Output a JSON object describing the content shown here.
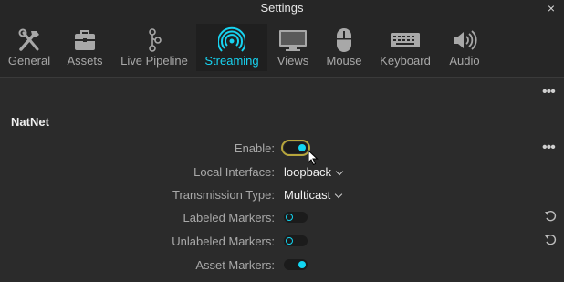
{
  "window": {
    "title": "Settings",
    "close_glyph": "×"
  },
  "tabs": [
    {
      "label": "General",
      "icon": "tools-icon"
    },
    {
      "label": "Assets",
      "icon": "toolbox-icon"
    },
    {
      "label": "Live Pipeline",
      "icon": "pipeline-icon"
    },
    {
      "label": "Streaming",
      "icon": "streaming-icon",
      "active": true
    },
    {
      "label": "Views",
      "icon": "monitor-icon"
    },
    {
      "label": "Mouse",
      "icon": "mouse-icon"
    },
    {
      "label": "Keyboard",
      "icon": "keyboard-icon"
    },
    {
      "label": "Audio",
      "icon": "speaker-icon"
    }
  ],
  "section": {
    "title": "NatNet"
  },
  "fields": {
    "enable": {
      "label": "Enable:",
      "value": true
    },
    "local_interface": {
      "label": "Local Interface:",
      "value": "loopback"
    },
    "transmission_type": {
      "label": "Transmission Type:",
      "value": "Multicast"
    },
    "labeled_markers": {
      "label": "Labeled Markers:",
      "value": false
    },
    "unlabeled_markers": {
      "label": "Unlabeled Markers:",
      "value": false
    },
    "asset_markers": {
      "label": "Asset Markers:",
      "value": true
    }
  },
  "more_glyph": "•••",
  "colors": {
    "accent": "#12d6f2",
    "focus": "#b7a63c",
    "background": "#2b2b2b",
    "header": "#262626"
  }
}
